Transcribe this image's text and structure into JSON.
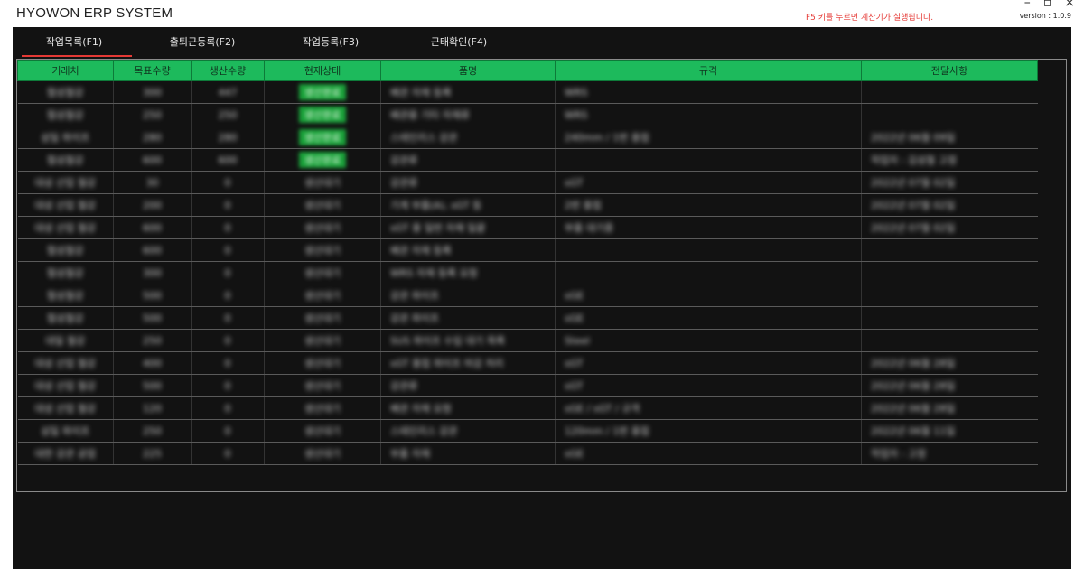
{
  "app": {
    "title": "HYOWON ERP SYSTEM",
    "hint": "F5 키를 누르면 계산기가 실행됩니다.",
    "version": "version : 1.0.9",
    "controls": {
      "minimize": "–",
      "restore": "▫",
      "close": "×"
    }
  },
  "tabs": [
    {
      "label": "작업목록(F1)",
      "active": true
    },
    {
      "label": "출퇴근등록(F2)",
      "active": false
    },
    {
      "label": "작업등록(F3)",
      "active": false
    },
    {
      "label": "근태확인(F4)",
      "active": false
    }
  ],
  "table": {
    "columns": [
      "거래처",
      "목표수량",
      "생산수량",
      "현재상태",
      "품명",
      "규격",
      "전달사항"
    ],
    "rows": [
      [
        "협성철강",
        "300",
        "447",
        "생산완료",
        "배관 자재 등록",
        "WRS",
        ""
      ],
      [
        "협성철강",
        "250",
        "250",
        "생산완료",
        "배관용 기타 자재류",
        "WRS",
        ""
      ],
      [
        "삼일 파이프",
        "280",
        "280",
        "생산완료",
        "스테인리스 강관",
        "240mm / 1번 용접",
        "2022년 06월 09일"
      ],
      [
        "협성철강",
        "600",
        "600",
        "생산완료",
        "강관류",
        "",
        "작업자 : 김성철 고정"
      ],
      [
        "대성 산업 철강",
        "30",
        "0",
        "생산대기",
        "강관류",
        "sGT",
        "2022년 07월 02일"
      ],
      [
        "대성 산업 철강",
        "200",
        "0",
        "생산대기",
        "기계 부품(A), sGT 등",
        "2번 용접",
        "2022년 07월 02일"
      ],
      [
        "대성 산업 철강",
        "600",
        "0",
        "생산대기",
        "sGT 용 일반 자재 일괄",
        "부품 대기중",
        "2022년 07월 02일"
      ],
      [
        "협성철강",
        "600",
        "0",
        "생산대기",
        "배관 자재 등록",
        "",
        ""
      ],
      [
        "협성철강",
        "300",
        "0",
        "생산대기",
        "WRS 자재 등록 요청",
        "",
        ""
      ],
      [
        "협성철강",
        "500",
        "0",
        "생산대기",
        "강관 파이프",
        "sGE",
        ""
      ],
      [
        "협성철강",
        "500",
        "0",
        "생산대기",
        "강관 파이프",
        "sGE",
        ""
      ],
      [
        "대일 철강",
        "250",
        "0",
        "생산대기",
        "SUS 파이프 수입 대기 목록",
        "Steel",
        ""
      ],
      [
        "대성 산업 철강",
        "400",
        "0",
        "생산대기",
        "sGT 용접 파이프 마감 처리",
        "sGT",
        "2022년 06월 28일"
      ],
      [
        "대성 산업 철강",
        "500",
        "0",
        "생산대기",
        "강관류",
        "sGT",
        "2022년 06월 28일"
      ],
      [
        "대성 산업 철강",
        "120",
        "0",
        "생산대기",
        "배관 자재 요청",
        "sGE / sGT / 규격",
        "2022년 06월 28일"
      ],
      [
        "삼일 파이프",
        "250",
        "0",
        "생산대기",
        "스테인리스 강관",
        "120mm / 1번 용접",
        "2022년 06월 11일"
      ],
      [
        "대한 강관 공업",
        "225",
        "0",
        "생산대기",
        "부품 자재",
        "sGE",
        "작업자 : 고정"
      ]
    ]
  }
}
